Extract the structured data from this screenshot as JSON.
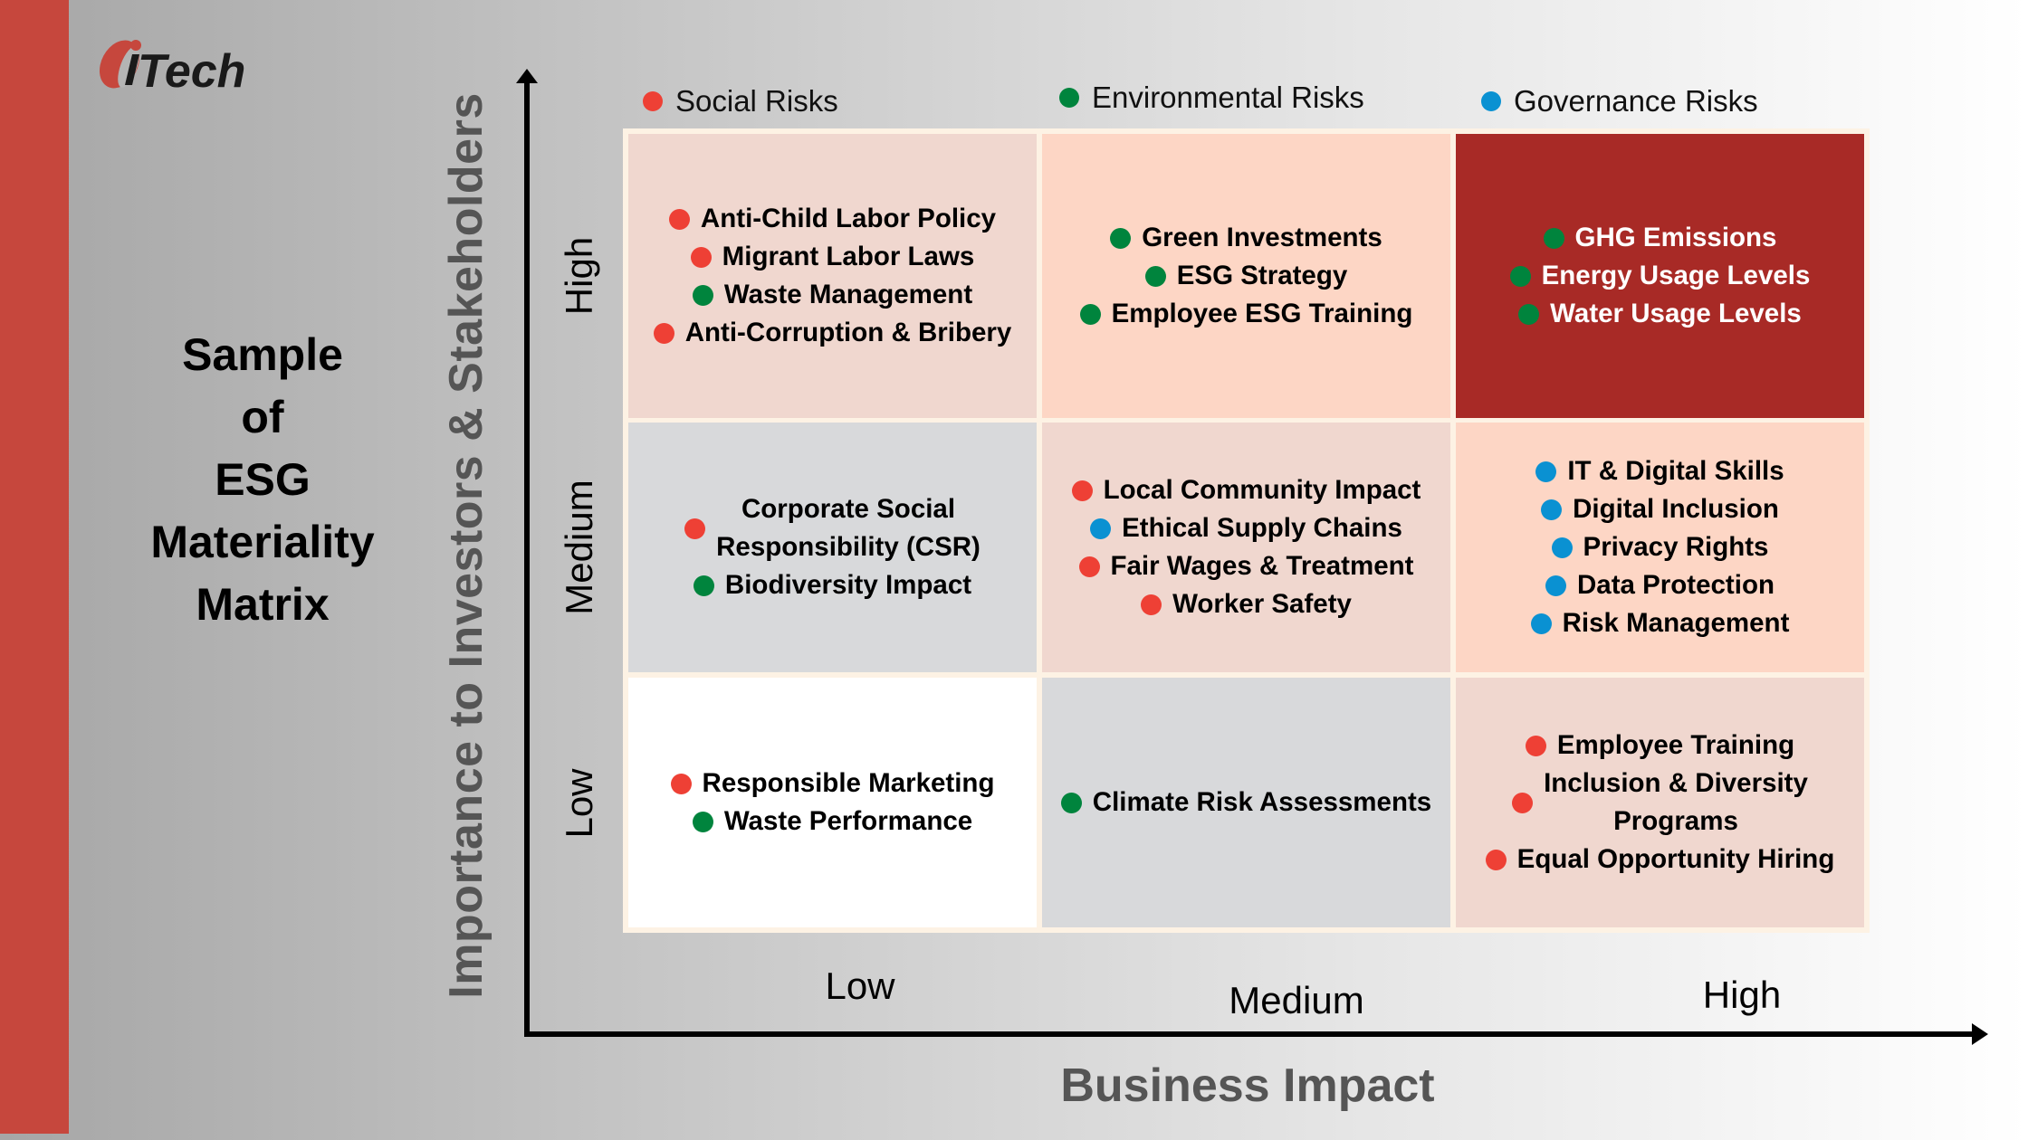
{
  "brand": {
    "logo_text": "Tech",
    "logo_letter": "i",
    "stripe_color": "#C6473D",
    "logo_accent": "#C6473D",
    "logo_text_color": "#1a1a1a"
  },
  "title_lines": [
    "Sample",
    "of",
    "ESG",
    "Materiality",
    "Matrix"
  ],
  "legend": [
    {
      "label": "Social Risks",
      "category": "social",
      "color": "#EE4035"
    },
    {
      "label": "Environmental Risks",
      "category": "environmental",
      "color": "#00843D"
    },
    {
      "label": "Governance Risks",
      "category": "governance",
      "color": "#0A91D2"
    }
  ],
  "colors": {
    "social": "#EE4035",
    "environmental": "#00843D",
    "governance": "#0A91D2",
    "frame": "#FDF2E4",
    "axis": "#000000"
  },
  "chart_data": {
    "type": "table",
    "title": "Sample of ESG Materiality Matrix",
    "xlabel": "Business Impact",
    "ylabel": "Importance to Investors & Stakeholders",
    "x_ticks": [
      "Low",
      "Medium",
      "High"
    ],
    "y_ticks": [
      "High",
      "Medium",
      "Low"
    ],
    "legend_position": "top",
    "rows": [
      {
        "importance": "High",
        "cells": [
          {
            "impact": "Low",
            "fill": "#F0D7CF",
            "items": [
              {
                "label": "Anti-Child Labor Policy",
                "category": "social"
              },
              {
                "label": "Migrant Labor Laws",
                "category": "social"
              },
              {
                "label": "Waste Management",
                "category": "environmental"
              },
              {
                "label": "Anti-Corruption & Bribery",
                "category": "social"
              }
            ]
          },
          {
            "impact": "Medium",
            "fill": "#FDD6C5",
            "items": [
              {
                "label": "Green Investments",
                "category": "environmental"
              },
              {
                "label": "ESG Strategy",
                "category": "environmental"
              },
              {
                "label": "Employee ESG Training",
                "category": "environmental"
              }
            ]
          },
          {
            "impact": "High",
            "fill": "#A82A26",
            "dark": true,
            "items": [
              {
                "label": "GHG Emissions",
                "category": "environmental"
              },
              {
                "label": "Energy Usage Levels",
                "category": "environmental"
              },
              {
                "label": "Water Usage Levels",
                "category": "environmental"
              }
            ]
          }
        ]
      },
      {
        "importance": "Medium",
        "cells": [
          {
            "impact": "Low",
            "fill": "#D8D9DB",
            "items": [
              {
                "label": "Corporate Social\nResponsibility (CSR)",
                "category": "social"
              },
              {
                "label": "Biodiversity Impact",
                "category": "environmental"
              }
            ]
          },
          {
            "impact": "Medium",
            "fill": "#F0D7CF",
            "items": [
              {
                "label": "Local Community Impact",
                "category": "social"
              },
              {
                "label": "Ethical Supply Chains",
                "category": "governance"
              },
              {
                "label": "Fair Wages & Treatment",
                "category": "social"
              },
              {
                "label": "Worker Safety",
                "category": "social"
              }
            ]
          },
          {
            "impact": "High",
            "fill": "#FDD6C5",
            "items": [
              {
                "label": "IT & Digital Skills",
                "category": "governance"
              },
              {
                "label": "Digital Inclusion",
                "category": "governance"
              },
              {
                "label": "Privacy Rights",
                "category": "governance"
              },
              {
                "label": "Data Protection",
                "category": "governance"
              },
              {
                "label": "Risk Management",
                "category": "governance"
              }
            ]
          }
        ]
      },
      {
        "importance": "Low",
        "cells": [
          {
            "impact": "Low",
            "fill": "#FFFFFF",
            "items": [
              {
                "label": "Responsible Marketing",
                "category": "social"
              },
              {
                "label": "Waste Performance",
                "category": "environmental"
              }
            ]
          },
          {
            "impact": "Medium",
            "fill": "#D8D9DB",
            "items": [
              {
                "label": "Climate Risk Assessments",
                "category": "environmental"
              }
            ]
          },
          {
            "impact": "High",
            "fill": "#F0D7CF",
            "items": [
              {
                "label": "Employee Training",
                "category": "social"
              },
              {
                "label": "Inclusion & Diversity\nPrograms",
                "category": "social"
              },
              {
                "label": "Equal Opportunity Hiring",
                "category": "social"
              }
            ]
          }
        ]
      }
    ]
  }
}
